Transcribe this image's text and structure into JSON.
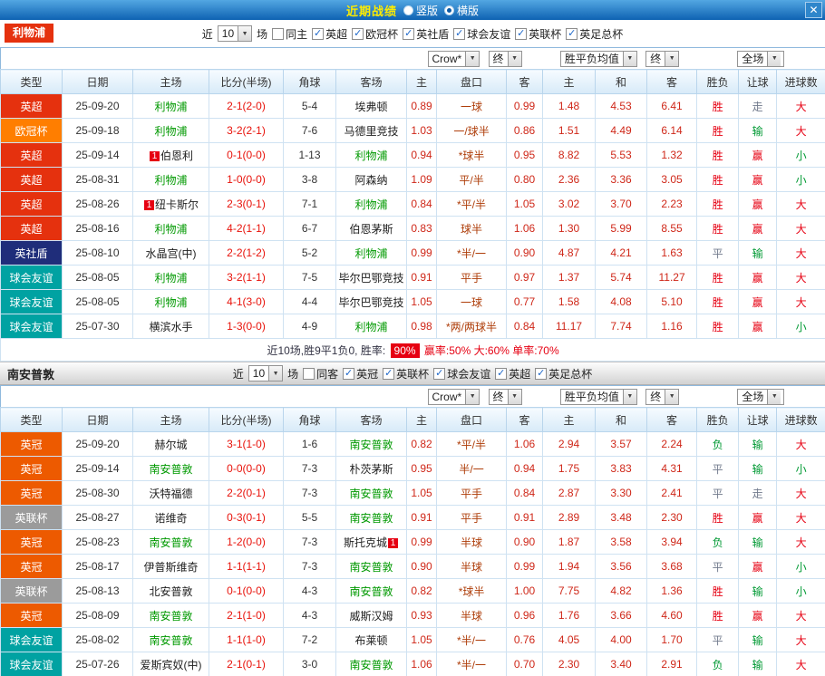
{
  "topbar": {
    "title": "近期战绩",
    "vertical_label": "竖版",
    "horizontal_label": "横版",
    "close_label": "✕"
  },
  "table_headers": {
    "type": "类型",
    "date": "日期",
    "home": "主场",
    "score": "比分(半场)",
    "corner": "角球",
    "away": "客场",
    "asia_home": "主",
    "asia_handicap": "盘口",
    "asia_away": "客",
    "eu_home": "主",
    "eu_draw": "和",
    "eu_away": "客",
    "result": "胜负",
    "handicap_result": "让球",
    "goals": "进球数"
  },
  "colors": {
    "league": {
      "英超": "#e5310e",
      "欧冠杯": "#ff7e00",
      "英社盾": "#1f2d7a",
      "球会友谊": "#00a2a2",
      "英冠": "#ed5a00",
      "英联杯": "#9b9b9b"
    },
    "outcome": {
      "胜": "#e60012",
      "平": "#717a8c",
      "负": "#009933",
      "赢": "#e60012",
      "走": "#717a8c",
      "输": "#009933",
      "大": "#e60012",
      "小": "#009933"
    }
  },
  "sections": [
    {
      "team": "利物浦",
      "filters": {
        "near": "近",
        "count": "10",
        "unit": "场",
        "same": "同主",
        "same_checked": false,
        "leagues": [
          {
            "label": "英超",
            "checked": true
          },
          {
            "label": "欧冠杯",
            "checked": true
          },
          {
            "label": "英社盾",
            "checked": true
          },
          {
            "label": "球会友谊",
            "checked": true
          },
          {
            "label": "英联杯",
            "checked": true
          },
          {
            "label": "英足总杯",
            "checked": true
          }
        ]
      },
      "selectors": {
        "book": "Crow*",
        "book_state": "终",
        "europe": "胜平负均值",
        "europe_state": "终",
        "scope": "全场"
      },
      "rows": [
        {
          "league": "英超",
          "date": "25-09-20",
          "home": "利物浦",
          "home_focus": true,
          "away": "埃弗顿",
          "score": "2-1(2-0)",
          "corner": "5-4",
          "a_home": "0.89",
          "handicap": "一球",
          "a_away": "0.99",
          "e_home": "1.48",
          "e_draw": "4.53",
          "e_away": "6.41",
          "result": "胜",
          "let": "走",
          "goal": "大"
        },
        {
          "league": "欧冠杯",
          "date": "25-09-18",
          "home": "利物浦",
          "home_focus": true,
          "away": "马德里竞技",
          "score": "3-2(2-1)",
          "corner": "7-6",
          "a_home": "1.03",
          "handicap": "一/球半",
          "a_away": "0.86",
          "e_home": "1.51",
          "e_draw": "4.49",
          "e_away": "6.14",
          "result": "胜",
          "let": "输",
          "goal": "大"
        },
        {
          "league": "英超",
          "date": "25-09-14",
          "home": "伯恩利",
          "home_card": "1",
          "away": "利物浦",
          "away_focus": true,
          "score": "0-1(0-0)",
          "corner": "1-13",
          "a_home": "0.94",
          "handicap": "*球半",
          "a_away": "0.95",
          "e_home": "8.82",
          "e_draw": "5.53",
          "e_away": "1.32",
          "result": "胜",
          "let": "赢",
          "goal": "小"
        },
        {
          "league": "英超",
          "date": "25-08-31",
          "home": "利物浦",
          "home_focus": true,
          "away": "阿森纳",
          "score": "1-0(0-0)",
          "corner": "3-8",
          "a_home": "1.09",
          "handicap": "平/半",
          "a_away": "0.80",
          "e_home": "2.36",
          "e_draw": "3.36",
          "e_away": "3.05",
          "result": "胜",
          "let": "赢",
          "goal": "小"
        },
        {
          "league": "英超",
          "date": "25-08-26",
          "home": "纽卡斯尔",
          "home_card": "1",
          "away": "利物浦",
          "away_focus": true,
          "score": "2-3(0-1)",
          "corner": "7-1",
          "a_home": "0.84",
          "handicap": "*平/半",
          "a_away": "1.05",
          "e_home": "3.02",
          "e_draw": "3.70",
          "e_away": "2.23",
          "result": "胜",
          "let": "赢",
          "goal": "大"
        },
        {
          "league": "英超",
          "date": "25-08-16",
          "home": "利物浦",
          "home_focus": true,
          "away": "伯恩茅斯",
          "score": "4-2(1-1)",
          "corner": "6-7",
          "a_home": "0.83",
          "handicap": "球半",
          "a_away": "1.06",
          "e_home": "1.30",
          "e_draw": "5.99",
          "e_away": "8.55",
          "result": "胜",
          "let": "赢",
          "goal": "大"
        },
        {
          "league": "英社盾",
          "date": "25-08-10",
          "home": "水晶宫(中)",
          "away": "利物浦",
          "away_focus": true,
          "score": "2-2(1-2)",
          "corner": "5-2",
          "a_home": "0.99",
          "handicap": "*半/一",
          "a_away": "0.90",
          "e_home": "4.87",
          "e_draw": "4.21",
          "e_away": "1.63",
          "result": "平",
          "let": "输",
          "goal": "大"
        },
        {
          "league": "球会友谊",
          "date": "25-08-05",
          "home": "利物浦",
          "home_focus": true,
          "away": "毕尔巴鄂竞技",
          "score": "3-2(1-1)",
          "corner": "7-5",
          "a_home": "0.91",
          "handicap": "平手",
          "a_away": "0.97",
          "e_home": "1.37",
          "e_draw": "5.74",
          "e_away": "11.27",
          "result": "胜",
          "let": "赢",
          "goal": "大"
        },
        {
          "league": "球会友谊",
          "date": "25-08-05",
          "home": "利物浦",
          "home_focus": true,
          "away": "毕尔巴鄂竞技",
          "score": "4-1(3-0)",
          "corner": "4-4",
          "a_home": "1.05",
          "handicap": "一球",
          "a_away": "0.77",
          "e_home": "1.58",
          "e_draw": "4.08",
          "e_away": "5.10",
          "result": "胜",
          "let": "赢",
          "goal": "大"
        },
        {
          "league": "球会友谊",
          "date": "25-07-30",
          "home": "横滨水手",
          "away": "利物浦",
          "away_focus": true,
          "score": "1-3(0-0)",
          "corner": "4-9",
          "a_home": "0.98",
          "handicap": "*两/两球半",
          "a_away": "0.84",
          "e_home": "11.17",
          "e_draw": "7.74",
          "e_away": "1.16",
          "result": "胜",
          "let": "赢",
          "goal": "小"
        }
      ],
      "summary": {
        "prefix": "近10场,胜9平1负0, 胜率:",
        "win_rate": "90%",
        "rest": "赢率:50% 大:60% 单率:70%"
      }
    },
    {
      "team": "南安普敦",
      "filters": {
        "near": "近",
        "count": "10",
        "unit": "场",
        "same": "同客",
        "same_checked": false,
        "leagues": [
          {
            "label": "英冠",
            "checked": true
          },
          {
            "label": "英联杯",
            "checked": true
          },
          {
            "label": "球会友谊",
            "checked": true
          },
          {
            "label": "英超",
            "checked": true
          },
          {
            "label": "英足总杯",
            "checked": true
          }
        ]
      },
      "selectors": {
        "book": "Crow*",
        "book_state": "终",
        "europe": "胜平负均值",
        "europe_state": "终",
        "scope": "全场"
      },
      "rows": [
        {
          "league": "英冠",
          "date": "25-09-20",
          "home": "赫尔城",
          "away": "南安普敦",
          "away_focus": true,
          "score": "3-1(1-0)",
          "corner": "1-6",
          "a_home": "0.82",
          "handicap": "*平/半",
          "a_away": "1.06",
          "e_home": "2.94",
          "e_draw": "3.57",
          "e_away": "2.24",
          "result": "负",
          "let": "输",
          "goal": "大"
        },
        {
          "league": "英冠",
          "date": "25-09-14",
          "home": "南安普敦",
          "home_focus": true,
          "away": "朴茨茅斯",
          "score": "0-0(0-0)",
          "corner": "7-3",
          "a_home": "0.95",
          "handicap": "半/一",
          "a_away": "0.94",
          "e_home": "1.75",
          "e_draw": "3.83",
          "e_away": "4.31",
          "result": "平",
          "let": "输",
          "goal": "小"
        },
        {
          "league": "英冠",
          "date": "25-08-30",
          "home": "沃特福德",
          "away": "南安普敦",
          "away_focus": true,
          "score": "2-2(0-1)",
          "corner": "7-3",
          "a_home": "1.05",
          "handicap": "平手",
          "a_away": "0.84",
          "e_home": "2.87",
          "e_draw": "3.30",
          "e_away": "2.41",
          "result": "平",
          "let": "走",
          "goal": "大"
        },
        {
          "league": "英联杯",
          "date": "25-08-27",
          "home": "诺维奇",
          "away": "南安普敦",
          "away_focus": true,
          "score": "0-3(0-1)",
          "corner": "5-5",
          "a_home": "0.91",
          "handicap": "平手",
          "a_away": "0.91",
          "e_home": "2.89",
          "e_draw": "3.48",
          "e_away": "2.30",
          "result": "胜",
          "let": "赢",
          "goal": "大"
        },
        {
          "league": "英冠",
          "date": "25-08-23",
          "home": "南安普敦",
          "home_focus": true,
          "away": "斯托克城",
          "away_card": "1",
          "score": "1-2(0-0)",
          "corner": "7-3",
          "a_home": "0.99",
          "handicap": "半球",
          "a_away": "0.90",
          "e_home": "1.87",
          "e_draw": "3.58",
          "e_away": "3.94",
          "result": "负",
          "let": "输",
          "goal": "大"
        },
        {
          "league": "英冠",
          "date": "25-08-17",
          "home": "伊普斯维奇",
          "away": "南安普敦",
          "away_focus": true,
          "score": "1-1(1-1)",
          "corner": "7-3",
          "a_home": "0.90",
          "handicap": "半球",
          "a_away": "0.99",
          "e_home": "1.94",
          "e_draw": "3.56",
          "e_away": "3.68",
          "result": "平",
          "let": "赢",
          "goal": "小"
        },
        {
          "league": "英联杯",
          "date": "25-08-13",
          "home": "北安普敦",
          "away": "南安普敦",
          "away_focus": true,
          "score": "0-1(0-0)",
          "corner": "4-3",
          "a_home": "0.82",
          "handicap": "*球半",
          "a_away": "1.00",
          "e_home": "7.75",
          "e_draw": "4.82",
          "e_away": "1.36",
          "result": "胜",
          "let": "输",
          "goal": "小"
        },
        {
          "league": "英冠",
          "date": "25-08-09",
          "home": "南安普敦",
          "home_focus": true,
          "away": "威斯汉姆",
          "score": "2-1(1-0)",
          "corner": "4-3",
          "a_home": "0.93",
          "handicap": "半球",
          "a_away": "0.96",
          "e_home": "1.76",
          "e_draw": "3.66",
          "e_away": "4.60",
          "result": "胜",
          "let": "赢",
          "goal": "大"
        },
        {
          "league": "球会友谊",
          "date": "25-08-02",
          "home": "南安普敦",
          "home_focus": true,
          "away": "布莱顿",
          "score": "1-1(1-0)",
          "corner": "7-2",
          "a_home": "1.05",
          "handicap": "*半/一",
          "a_away": "0.76",
          "e_home": "4.05",
          "e_draw": "4.00",
          "e_away": "1.70",
          "result": "平",
          "let": "输",
          "goal": "大"
        },
        {
          "league": "球会友谊",
          "date": "25-07-26",
          "home": "爱斯宾奴(中)",
          "away": "南安普敦",
          "away_focus": true,
          "score": "2-1(0-1)",
          "corner": "3-0",
          "a_home": "1.06",
          "handicap": "*半/一",
          "a_away": "0.70",
          "e_home": "2.30",
          "e_draw": "3.40",
          "e_away": "2.91",
          "result": "负",
          "let": "输",
          "goal": "大"
        }
      ],
      "summary": null
    }
  ]
}
